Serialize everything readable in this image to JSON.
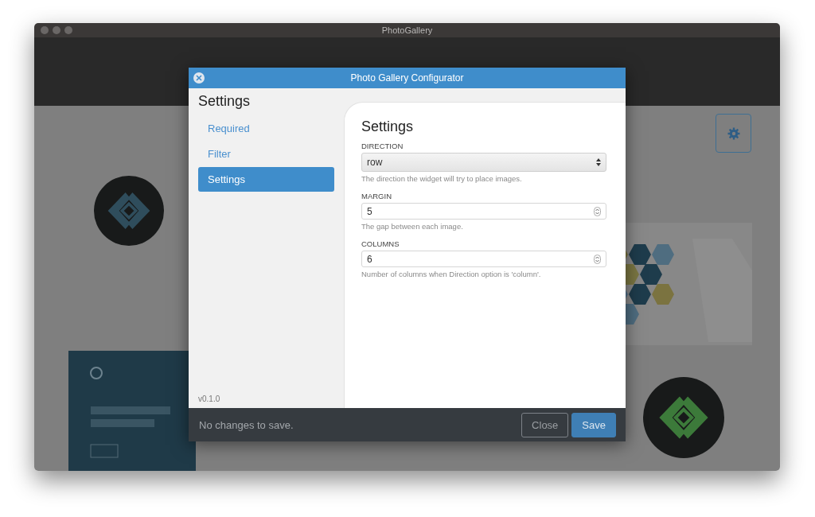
{
  "window": {
    "title": "PhotoGallery"
  },
  "gallery": {
    "images": [
      {
        "kind": "logo"
      },
      {
        "kind": "banner"
      },
      {
        "kind": "hexagons"
      },
      {
        "kind": "logo-green"
      }
    ]
  },
  "dialog": {
    "title": "Photo Gallery Configurator",
    "sidebar": {
      "heading": "Settings",
      "items": [
        {
          "label": "Required",
          "selected": false
        },
        {
          "label": "Filter",
          "selected": false
        },
        {
          "label": "Settings",
          "selected": true
        }
      ],
      "version": "v0.1.0"
    },
    "panel": {
      "heading": "Settings",
      "fields": [
        {
          "kind": "select",
          "label": "DIRECTION",
          "value": "row",
          "help": "The direction the widget will try to place images."
        },
        {
          "kind": "number",
          "label": "MARGIN",
          "value": "5",
          "help": "The gap between each image."
        },
        {
          "kind": "number",
          "label": "COLUMNS",
          "value": "6",
          "help": "Number of columns when Direction option is 'column'."
        }
      ]
    },
    "footer": {
      "status": "No changes to save.",
      "buttons": [
        {
          "label": "Close",
          "kind": "secondary"
        },
        {
          "label": "Save",
          "kind": "primary"
        }
      ]
    }
  }
}
